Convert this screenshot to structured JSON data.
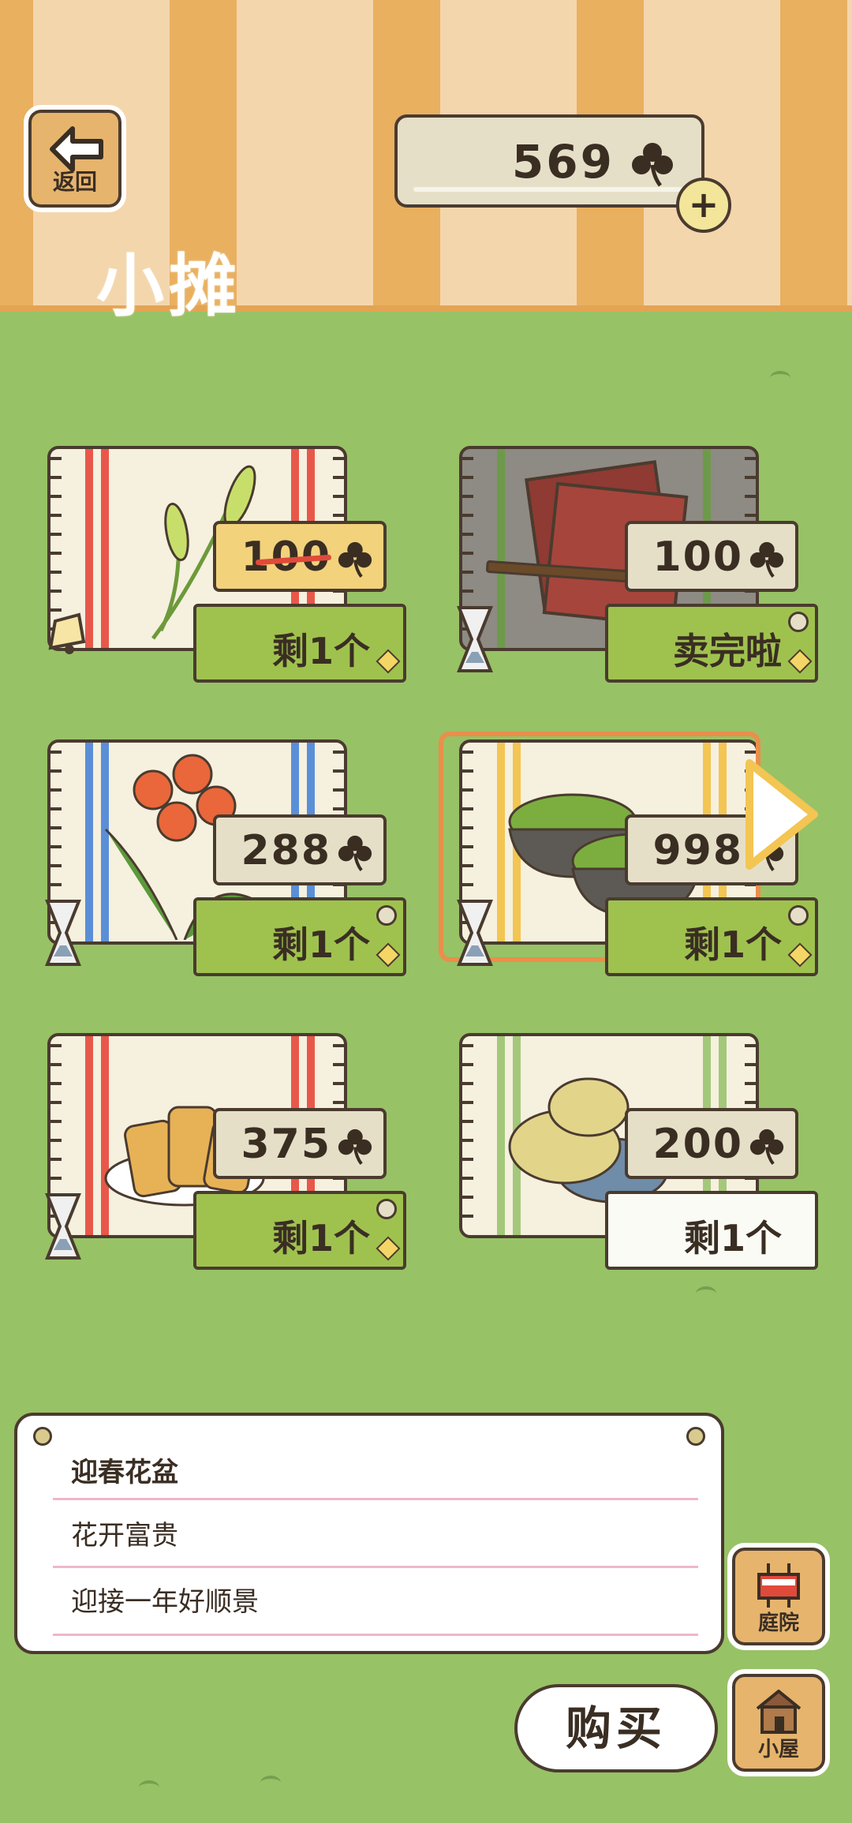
{
  "header": {
    "back_label": "返回",
    "title": "小摊",
    "currency_amount": "569"
  },
  "items": [
    {
      "name": "foxtail",
      "price": "100",
      "on_sale": true,
      "stock": "剩1个"
    },
    {
      "name": "calligraphy",
      "price": "100",
      "on_sale": false,
      "stock": "卖完啦"
    },
    {
      "name": "clivia",
      "price": "288",
      "on_sale": false,
      "stock": "剩1个"
    },
    {
      "name": "moss-pots",
      "price": "998",
      "on_sale": false,
      "stock": "剩1个",
      "selected": true
    },
    {
      "name": "spring-rolls",
      "price": "375",
      "on_sale": false,
      "stock": "剩1个"
    },
    {
      "name": "rope",
      "price": "200",
      "on_sale": false,
      "stock": "剩1个"
    }
  ],
  "description": {
    "name": "迎春花盆",
    "line1": "花开富贵",
    "line2": "迎接一年好顺景"
  },
  "buttons": {
    "buy": "购买",
    "yard": "庭院",
    "house": "小屋"
  },
  "colors": {
    "grass": "#98c266",
    "card": "#e6dfc8",
    "stock_green": "#9fc24e",
    "outline": "#4a3b2f",
    "selection": "#ea8f4a"
  }
}
